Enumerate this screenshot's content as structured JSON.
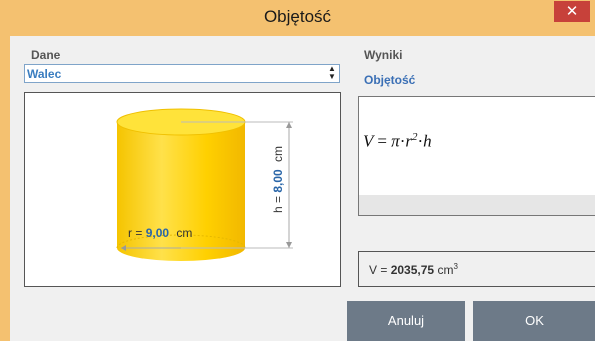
{
  "window": {
    "title": "Objętość",
    "close_glyph": "✕"
  },
  "data_section": {
    "label": "Dane",
    "shape_select": {
      "value": "Walec"
    },
    "figure": {
      "radius_label": "r =",
      "radius_value": "9,00",
      "radius_unit": "cm",
      "height_label": "h =",
      "height_value": "8,00",
      "height_unit": "cm"
    }
  },
  "results_section": {
    "label": "Wyniki",
    "title": "Objętość",
    "formula": {
      "lhs": "V",
      "eq": "=",
      "pi": "π",
      "r": "r",
      "exp": "2",
      "h": "h"
    },
    "result": {
      "prefix": "V =",
      "value": "2035,75",
      "unit": "cm",
      "unit_exp": "3"
    }
  },
  "buttons": {
    "cancel": "Anuluj",
    "ok": "OK"
  },
  "colors": {
    "cylinder": "#ffd800",
    "accent": "#3a7dc0",
    "close": "#c7413a",
    "button": "#6d7a88"
  }
}
